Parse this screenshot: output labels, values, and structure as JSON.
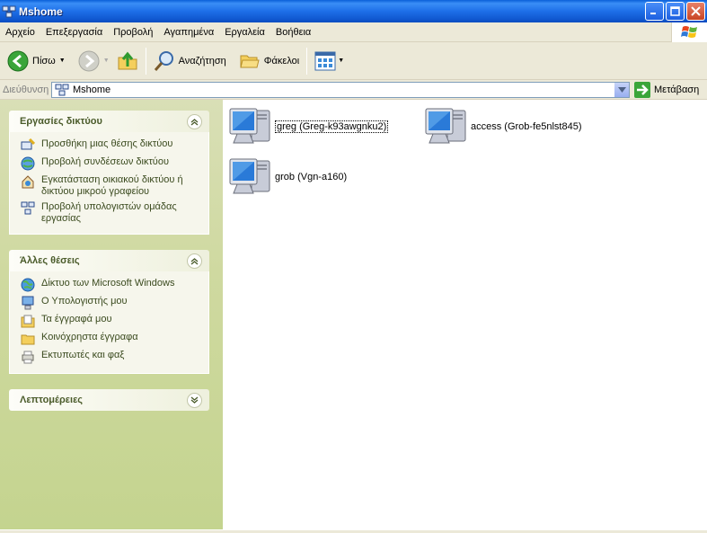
{
  "window": {
    "title": "Mshome"
  },
  "menu": {
    "items": [
      "Αρχείο",
      "Επεξεργασία",
      "Προβολή",
      "Αγαπημένα",
      "Εργαλεία",
      "Βοήθεια"
    ]
  },
  "toolbar": {
    "back_label": "Πίσω",
    "search_label": "Αναζήτηση",
    "folders_label": "Φάκελοι"
  },
  "address": {
    "label": "Διεύθυνση",
    "value": "Mshome",
    "go_label": "Μετάβαση"
  },
  "tasks_network": {
    "title": "Εργασίες δικτύου",
    "items": [
      {
        "label": "Προσθήκη μιας θέσης δικτύου",
        "icon": "add-network-place-icon"
      },
      {
        "label": "Προβολή συνδέσεων δικτύου",
        "icon": "network-connections-icon"
      },
      {
        "label": "Εγκατάσταση οικιακού δικτύου ή δικτύου μικρού γραφείου",
        "icon": "network-setup-icon"
      },
      {
        "label": "Προβολή υπολογιστών ομάδας εργασίας",
        "icon": "workgroup-computers-icon"
      }
    ]
  },
  "other_places": {
    "title": "Άλλες θέσεις",
    "items": [
      {
        "label": "Δίκτυο των Microsoft Windows",
        "icon": "windows-network-icon"
      },
      {
        "label": "Ο Υπολογιστής μου",
        "icon": "my-computer-icon"
      },
      {
        "label": "Τα έγγραφά μου",
        "icon": "my-documents-icon"
      },
      {
        "label": "Κοινόχρηστα έγγραφα",
        "icon": "shared-documents-icon"
      },
      {
        "label": "Εκτυπωτές και φαξ",
        "icon": "printers-icon"
      }
    ]
  },
  "details": {
    "title": "Λεπτομέρειες"
  },
  "computers": [
    {
      "label": "greg (Greg-k93awgnku2)",
      "selected": true
    },
    {
      "label": "access (Grob-fe5nlst845)",
      "selected": false
    },
    {
      "label": "grob (Vgn-a160)",
      "selected": false
    }
  ],
  "colors": {
    "titlebar": "#0a5fd8",
    "taskpane": "#cfd9a0",
    "link": "#3a4a1e"
  }
}
